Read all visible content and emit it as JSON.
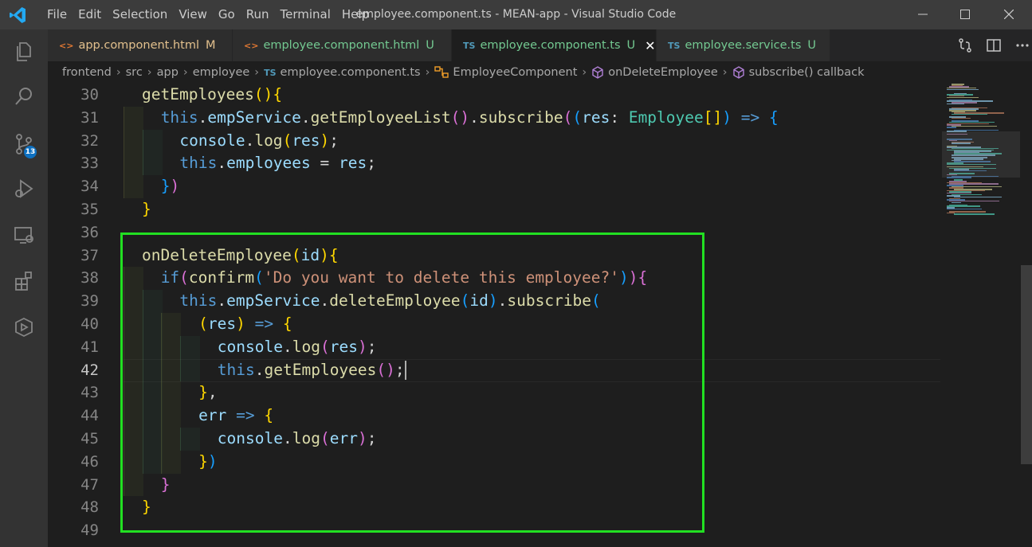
{
  "window": {
    "title": "employee.component.ts - MEAN-app - Visual Studio Code",
    "menu": [
      "File",
      "Edit",
      "Selection",
      "View",
      "Go",
      "Run",
      "Terminal",
      "Help"
    ]
  },
  "activity_bar": {
    "items": [
      {
        "name": "explorer",
        "icon": "files-icon"
      },
      {
        "name": "search",
        "icon": "search-icon"
      },
      {
        "name": "source-control",
        "icon": "source-control-icon",
        "badge": "13"
      },
      {
        "name": "run-debug",
        "icon": "run-debug-icon"
      },
      {
        "name": "remote-explorer",
        "icon": "remote-explorer-icon"
      },
      {
        "name": "extensions",
        "icon": "extensions-icon"
      },
      {
        "name": "angular",
        "icon": "angular-icon"
      }
    ]
  },
  "tabs": [
    {
      "label": "app.component.html",
      "icon": "<>",
      "status": "M",
      "color": "#e2c08d",
      "icon_color": "#e37933"
    },
    {
      "label": "employee.component.html",
      "icon": "<>",
      "status": "U",
      "color": "#73c991",
      "icon_color": "#e37933"
    },
    {
      "label": "employee.component.ts",
      "icon": "TS",
      "status": "U",
      "color": "#73c991",
      "icon_color": "#519aba",
      "active": true,
      "close": "✕"
    },
    {
      "label": "employee.service.ts",
      "icon": "TS",
      "status": "U",
      "color": "#73c991",
      "icon_color": "#519aba"
    }
  ],
  "breadcrumb": [
    "frontend",
    "src",
    "app",
    "employee",
    "employee.component.ts",
    "EmployeeComponent",
    "onDeleteEmployee",
    "subscribe() callback"
  ],
  "breadcrumb_icons": [
    "TS",
    "EmployeeComponent-class-icon",
    "method-icon",
    "method-icon"
  ],
  "editor": {
    "current_line": 42,
    "lines": [
      {
        "n": "30",
        "code": "getEmployees(){"
      },
      {
        "n": "31",
        "code": "this.empService.getEmployeeList().subscribe((res: Employee[]) => {"
      },
      {
        "n": "32",
        "code": "console.log(res);"
      },
      {
        "n": "33",
        "code": "this.employees = res;"
      },
      {
        "n": "34",
        "code": "})"
      },
      {
        "n": "35",
        "code": "}"
      },
      {
        "n": "36",
        "code": ""
      },
      {
        "n": "37",
        "code": "onDeleteEmployee(id){"
      },
      {
        "n": "38",
        "code": "if(confirm('Do you want to delete this employee?')){"
      },
      {
        "n": "39",
        "code": "this.empService.deleteEmployee(id).subscribe("
      },
      {
        "n": "40",
        "code": "(res) => {"
      },
      {
        "n": "41",
        "code": "console.log(res);"
      },
      {
        "n": "42",
        "code": "this.getEmployees();"
      },
      {
        "n": "43",
        "code": "},"
      },
      {
        "n": "44",
        "code": "err => {"
      },
      {
        "n": "45",
        "code": "console.log(err);"
      },
      {
        "n": "46",
        "code": "})"
      },
      {
        "n": "47",
        "code": "}"
      },
      {
        "n": "48",
        "code": "}"
      },
      {
        "n": "49",
        "code": ""
      }
    ]
  },
  "colors": {
    "keyword": "#569cd6",
    "function": "#dcdcaa",
    "variable": "#9cdcfe",
    "type": "#4ec9b0",
    "string": "#ce9178",
    "bracket1": "#ffd700",
    "bracket2": "#da70d6",
    "bracket3": "#179fff",
    "highlight": "#22e022"
  }
}
